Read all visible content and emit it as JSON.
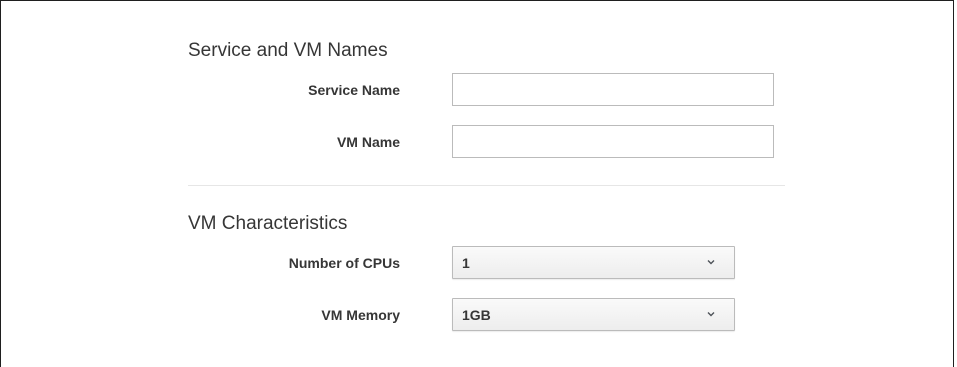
{
  "service_vm_names": {
    "title": "Service and VM Names",
    "service_name": {
      "label": "Service Name",
      "value": "",
      "placeholder": ""
    },
    "vm_name": {
      "label": "VM Name",
      "value": "",
      "placeholder": ""
    }
  },
  "vm_characteristics": {
    "title": "VM Characteristics",
    "cpus": {
      "label": "Number of CPUs",
      "selected": "1",
      "icon": "chevron-down-icon"
    },
    "memory": {
      "label": "VM Memory",
      "selected": "1GB",
      "icon": "chevron-down-icon"
    }
  }
}
